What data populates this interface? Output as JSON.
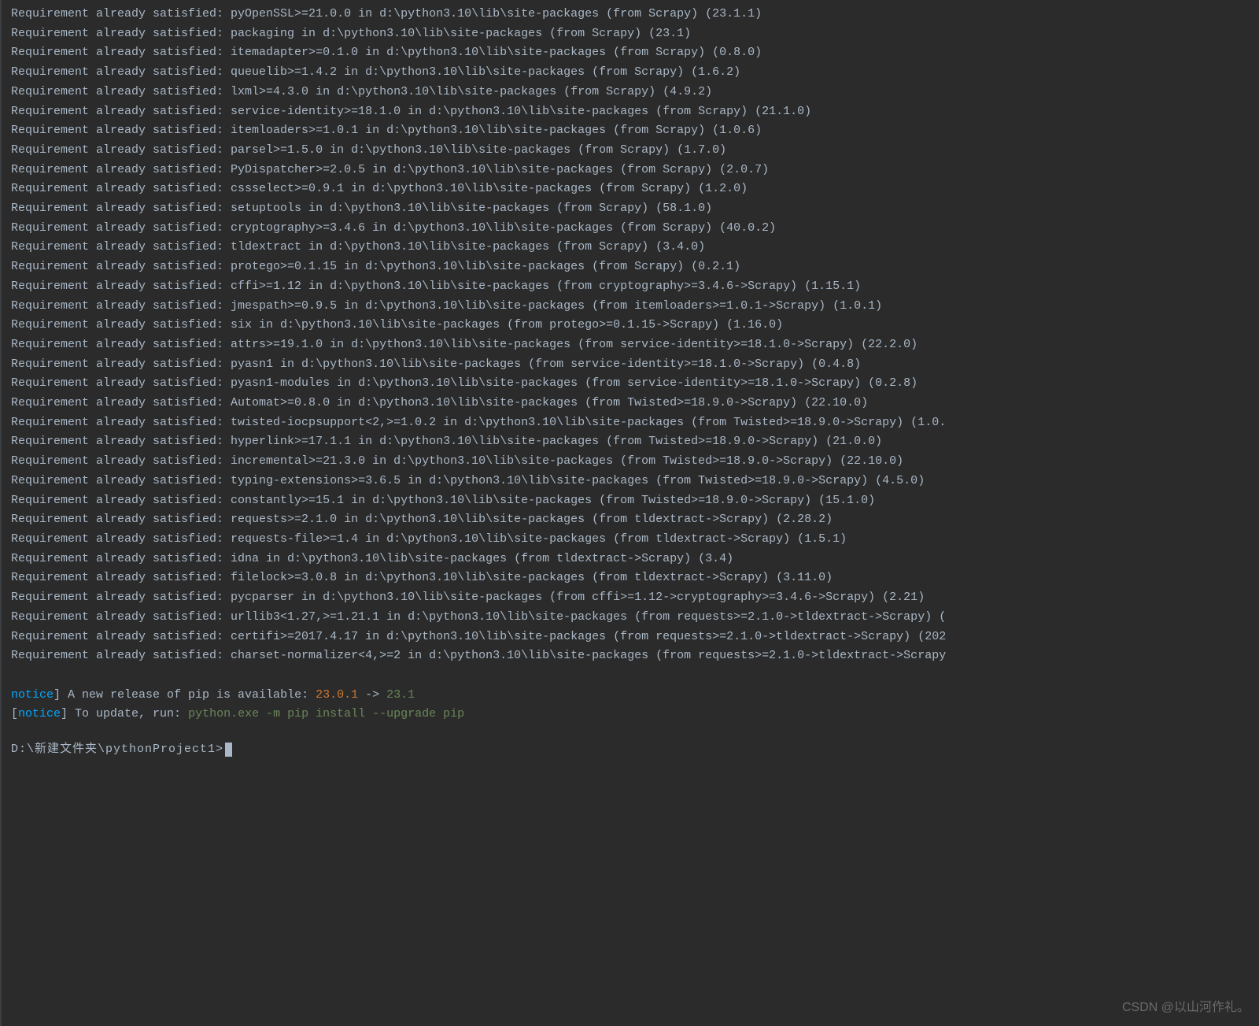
{
  "requirements": [
    "Requirement already satisfied: pyOpenSSL>=21.0.0 in d:\\python3.10\\lib\\site-packages (from Scrapy) (23.1.1)",
    "Requirement already satisfied: packaging in d:\\python3.10\\lib\\site-packages (from Scrapy) (23.1)",
    "Requirement already satisfied: itemadapter>=0.1.0 in d:\\python3.10\\lib\\site-packages (from Scrapy) (0.8.0)",
    "Requirement already satisfied: queuelib>=1.4.2 in d:\\python3.10\\lib\\site-packages (from Scrapy) (1.6.2)",
    "Requirement already satisfied: lxml>=4.3.0 in d:\\python3.10\\lib\\site-packages (from Scrapy) (4.9.2)",
    "Requirement already satisfied: service-identity>=18.1.0 in d:\\python3.10\\lib\\site-packages (from Scrapy) (21.1.0)",
    "Requirement already satisfied: itemloaders>=1.0.1 in d:\\python3.10\\lib\\site-packages (from Scrapy) (1.0.6)",
    "Requirement already satisfied: parsel>=1.5.0 in d:\\python3.10\\lib\\site-packages (from Scrapy) (1.7.0)",
    "Requirement already satisfied: PyDispatcher>=2.0.5 in d:\\python3.10\\lib\\site-packages (from Scrapy) (2.0.7)",
    "Requirement already satisfied: cssselect>=0.9.1 in d:\\python3.10\\lib\\site-packages (from Scrapy) (1.2.0)",
    "Requirement already satisfied: setuptools in d:\\python3.10\\lib\\site-packages (from Scrapy) (58.1.0)",
    "Requirement already satisfied: cryptography>=3.4.6 in d:\\python3.10\\lib\\site-packages (from Scrapy) (40.0.2)",
    "Requirement already satisfied: tldextract in d:\\python3.10\\lib\\site-packages (from Scrapy) (3.4.0)",
    "Requirement already satisfied: protego>=0.1.15 in d:\\python3.10\\lib\\site-packages (from Scrapy) (0.2.1)",
    "Requirement already satisfied: cffi>=1.12 in d:\\python3.10\\lib\\site-packages (from cryptography>=3.4.6->Scrapy) (1.15.1)",
    "Requirement already satisfied: jmespath>=0.9.5 in d:\\python3.10\\lib\\site-packages (from itemloaders>=1.0.1->Scrapy) (1.0.1)",
    "Requirement already satisfied: six in d:\\python3.10\\lib\\site-packages (from protego>=0.1.15->Scrapy) (1.16.0)",
    "Requirement already satisfied: attrs>=19.1.0 in d:\\python3.10\\lib\\site-packages (from service-identity>=18.1.0->Scrapy) (22.2.0)",
    "Requirement already satisfied: pyasn1 in d:\\python3.10\\lib\\site-packages (from service-identity>=18.1.0->Scrapy) (0.4.8)",
    "Requirement already satisfied: pyasn1-modules in d:\\python3.10\\lib\\site-packages (from service-identity>=18.1.0->Scrapy) (0.2.8)",
    "Requirement already satisfied: Automat>=0.8.0 in d:\\python3.10\\lib\\site-packages (from Twisted>=18.9.0->Scrapy) (22.10.0)",
    "Requirement already satisfied: twisted-iocpsupport<2,>=1.0.2 in d:\\python3.10\\lib\\site-packages (from Twisted>=18.9.0->Scrapy) (1.0.",
    "Requirement already satisfied: hyperlink>=17.1.1 in d:\\python3.10\\lib\\site-packages (from Twisted>=18.9.0->Scrapy) (21.0.0)",
    "Requirement already satisfied: incremental>=21.3.0 in d:\\python3.10\\lib\\site-packages (from Twisted>=18.9.0->Scrapy) (22.10.0)",
    "Requirement already satisfied: typing-extensions>=3.6.5 in d:\\python3.10\\lib\\site-packages (from Twisted>=18.9.0->Scrapy) (4.5.0)",
    "Requirement already satisfied: constantly>=15.1 in d:\\python3.10\\lib\\site-packages (from Twisted>=18.9.0->Scrapy) (15.1.0)",
    "Requirement already satisfied: requests>=2.1.0 in d:\\python3.10\\lib\\site-packages (from tldextract->Scrapy) (2.28.2)",
    "Requirement already satisfied: requests-file>=1.4 in d:\\python3.10\\lib\\site-packages (from tldextract->Scrapy) (1.5.1)",
    "Requirement already satisfied: idna in d:\\python3.10\\lib\\site-packages (from tldextract->Scrapy) (3.4)",
    "Requirement already satisfied: filelock>=3.0.8 in d:\\python3.10\\lib\\site-packages (from tldextract->Scrapy) (3.11.0)",
    "Requirement already satisfied: pycparser in d:\\python3.10\\lib\\site-packages (from cffi>=1.12->cryptography>=3.4.6->Scrapy) (2.21)",
    "Requirement already satisfied: urllib3<1.27,>=1.21.1 in d:\\python3.10\\lib\\site-packages (from requests>=2.1.0->tldextract->Scrapy) (",
    "Requirement already satisfied: certifi>=2017.4.17 in d:\\python3.10\\lib\\site-packages (from requests>=2.1.0->tldextract->Scrapy) (202",
    "Requirement already satisfied: charset-normalizer<4,>=2 in d:\\python3.10\\lib\\site-packages (from requests>=2.1.0->tldextract->Scrapy"
  ],
  "notice1": {
    "word": "notice",
    "text_before": "] A new release of pip is available: ",
    "old_version": "23.0.1",
    "arrow": " -> ",
    "new_version": "23.1"
  },
  "notice2": {
    "bracket_open": "[",
    "word": "notice",
    "text_before": "] To update, run: ",
    "command": "python.exe -m pip install --upgrade pip"
  },
  "prompt": "D:\\新建文件夹\\pythonProject1>",
  "watermark": "CSDN @以山河作礼。"
}
